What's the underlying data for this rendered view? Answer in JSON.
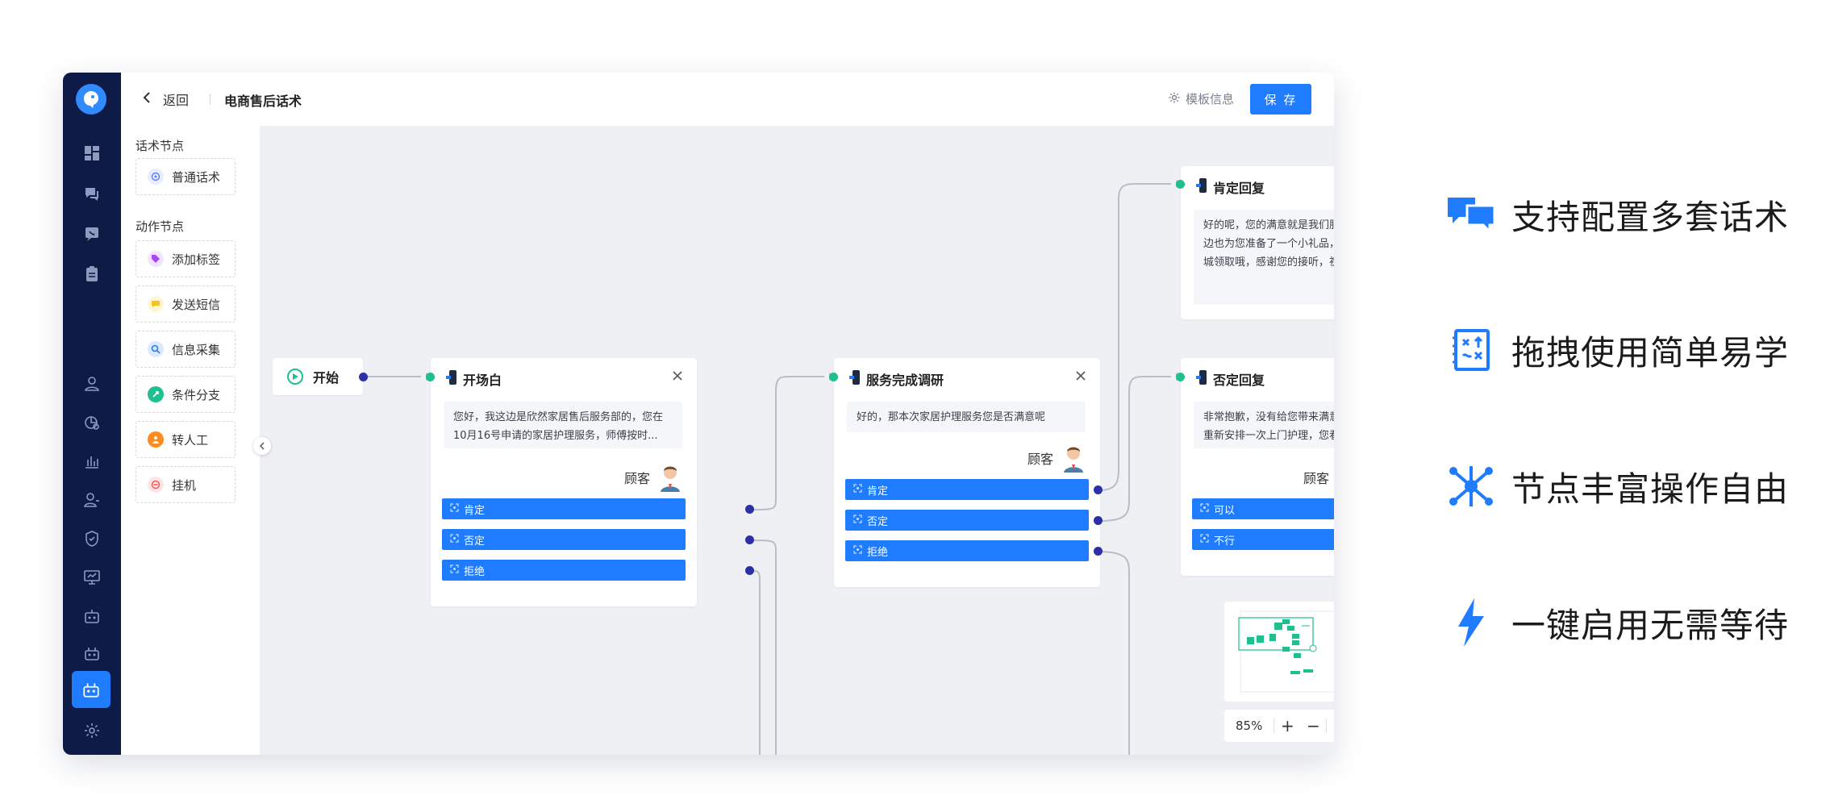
{
  "header": {
    "back_label": "返回",
    "title": "电商售后话术",
    "template_info_label": "模板信息",
    "save_label": "保 存"
  },
  "palette": {
    "script_section_title": "话术节点",
    "script_items": [
      {
        "label": "普通话术",
        "icon": "speech-icon",
        "color": "#5b7cff"
      }
    ],
    "action_section_title": "动作节点",
    "action_items": [
      {
        "label": "添加标签",
        "icon": "tag-icon",
        "color": "#a04cf5"
      },
      {
        "label": "发送短信",
        "icon": "message-icon",
        "color": "#f5c518"
      },
      {
        "label": "信息采集",
        "icon": "search-icon",
        "color": "#1f7cff"
      },
      {
        "label": "条件分支",
        "icon": "branch-icon",
        "color": "#1fbf8f"
      },
      {
        "label": "转人工",
        "icon": "transfer-icon",
        "color": "#ff8a1f"
      },
      {
        "label": "挂机",
        "icon": "hangup-icon",
        "color": "#ff4d4f"
      }
    ]
  },
  "canvas": {
    "start_label": "开始",
    "nodes": {
      "opening": {
        "title": "开场白",
        "text": "您好，我这边是欣然家居售后服务部的，您在10月16号申请的家居护理服务，师傅按时...",
        "speaker": "顾客",
        "branches": [
          "肯定",
          "否定",
          "拒绝"
        ]
      },
      "survey": {
        "title": "服务完成调研",
        "text": "好的，那本次家居护理服务您是否满意呢",
        "speaker": "顾客",
        "branches": [
          "肯定",
          "否定",
          "拒绝"
        ]
      },
      "positive": {
        "title": "肯定回复",
        "text": "好的呢，您的满意就是我们服务最大的动力，这边也为您准备了一个小礼品，您可以在小程序商城领取哦，感谢您的接听，祝您生活愉快，再见"
      },
      "negative": {
        "title": "否定回复",
        "text": "非常抱歉，没有给您带来满意的服务，这边为您重新安排一次上门护理，您看可以吗",
        "speaker": "顾客",
        "branches": [
          "可以",
          "不行"
        ]
      }
    },
    "zoom": "85%",
    "zoom_in": "+",
    "zoom_out": "−"
  },
  "features": [
    {
      "label": "支持配置多套话术",
      "icon": "chat-bubbles-icon"
    },
    {
      "label": "拖拽使用简单易学",
      "icon": "drag-board-icon"
    },
    {
      "label": "节点丰富操作自由",
      "icon": "network-icon"
    },
    {
      "label": "一键启用无需等待",
      "icon": "lightning-icon"
    }
  ],
  "colors": {
    "accent": "#1f7cff",
    "rail": "#0f1b47",
    "canvas": "#eef0f4",
    "port_in": "#1fbf8f",
    "port_out": "#2c2fa8"
  }
}
